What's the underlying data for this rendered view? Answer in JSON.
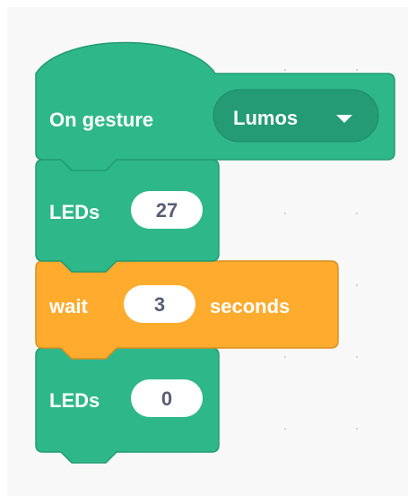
{
  "blocks": {
    "hat": {
      "label": "On gesture",
      "dropdown_value": "Lumos"
    },
    "leds_1": {
      "label": "LEDs",
      "value": "27"
    },
    "wait": {
      "label": "wait",
      "value": "3",
      "suffix": "seconds"
    },
    "leds_2": {
      "label": "LEDs",
      "value": "0"
    }
  },
  "colors": {
    "workspace_bg": "#f8f8f8",
    "event_block": "#2eb88a",
    "event_block_border": "#229a73",
    "event_dropdown": "#249b74",
    "control_block": "#ffab2e",
    "control_block_border": "#d99022",
    "field_bg": "#ffffff",
    "field_text": "#575e75"
  },
  "icons": {
    "dropdown_arrow": "caret-down-icon"
  }
}
